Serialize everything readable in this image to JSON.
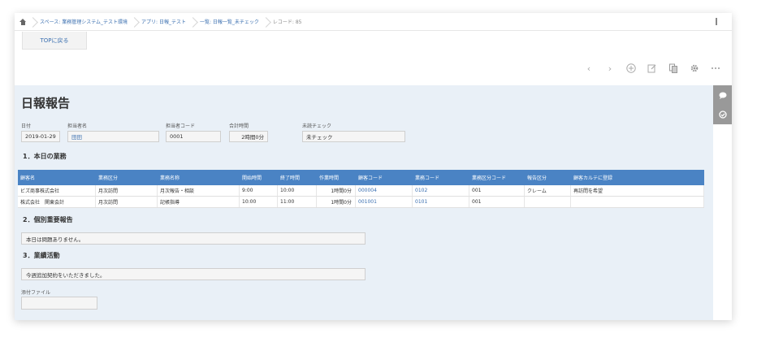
{
  "breadcrumb": {
    "items": [
      {
        "label": "スペース: 業務管理システム_テスト環境",
        "link": true
      },
      {
        "label": "アプリ: 日報_テスト",
        "link": true
      },
      {
        "label": "一覧: 日報一覧_未チェック",
        "link": true
      },
      {
        "label": "レコード: 85",
        "link": false
      }
    ]
  },
  "top_tab": {
    "label": "TOPに戻る"
  },
  "toolbar": {
    "icons": [
      "chevron-left-icon",
      "chevron-right-icon",
      "add-icon",
      "edit-icon",
      "copy-icon",
      "gear-icon",
      "more-icon"
    ]
  },
  "record": {
    "title": "日報報告",
    "fields": {
      "date": {
        "label": "日付",
        "value": "2019-01-29"
      },
      "person": {
        "label": "担当者名",
        "value": "田田"
      },
      "person_code": {
        "label": "担当者コード",
        "value": "0001"
      },
      "total_time": {
        "label": "合計時間",
        "value": "2時間0分"
      },
      "check": {
        "label": "未読チェック",
        "value": "未チェック"
      }
    },
    "section1": {
      "title": "1．本日の業務",
      "columns": [
        "顧客名",
        "業務区分",
        "業務名称",
        "開始時間",
        "終了時間",
        "作業時間",
        "顧客コード",
        "業務コード",
        "業務区分コード",
        "報告区分",
        "顧客カルテに登録"
      ],
      "rows": [
        [
          "ビズ商事株式会社",
          "月次訪問",
          "月次報告・相談",
          "9:00",
          "10:00",
          "1時間0分",
          "000004",
          "0102",
          "001",
          "クレーム",
          "再訪問を希望"
        ],
        [
          "株式会社　関東会計",
          "月次訪問",
          "記帳指導",
          "10:00",
          "11:00",
          "1時間0分",
          "001001",
          "0101",
          "001",
          "",
          ""
        ]
      ]
    },
    "section2": {
      "title": "2．個別重要報告",
      "value": "本日は問題ありません。"
    },
    "section3": {
      "title": "3．業績活動",
      "value": "今週追加契約をいただきました。"
    },
    "attachment": {
      "label": "添付ファイル",
      "value": ""
    }
  },
  "colors": {
    "header_blue": "#4a83c4",
    "link_blue": "#3a6fb0",
    "content_bg": "#e9f0f7"
  }
}
